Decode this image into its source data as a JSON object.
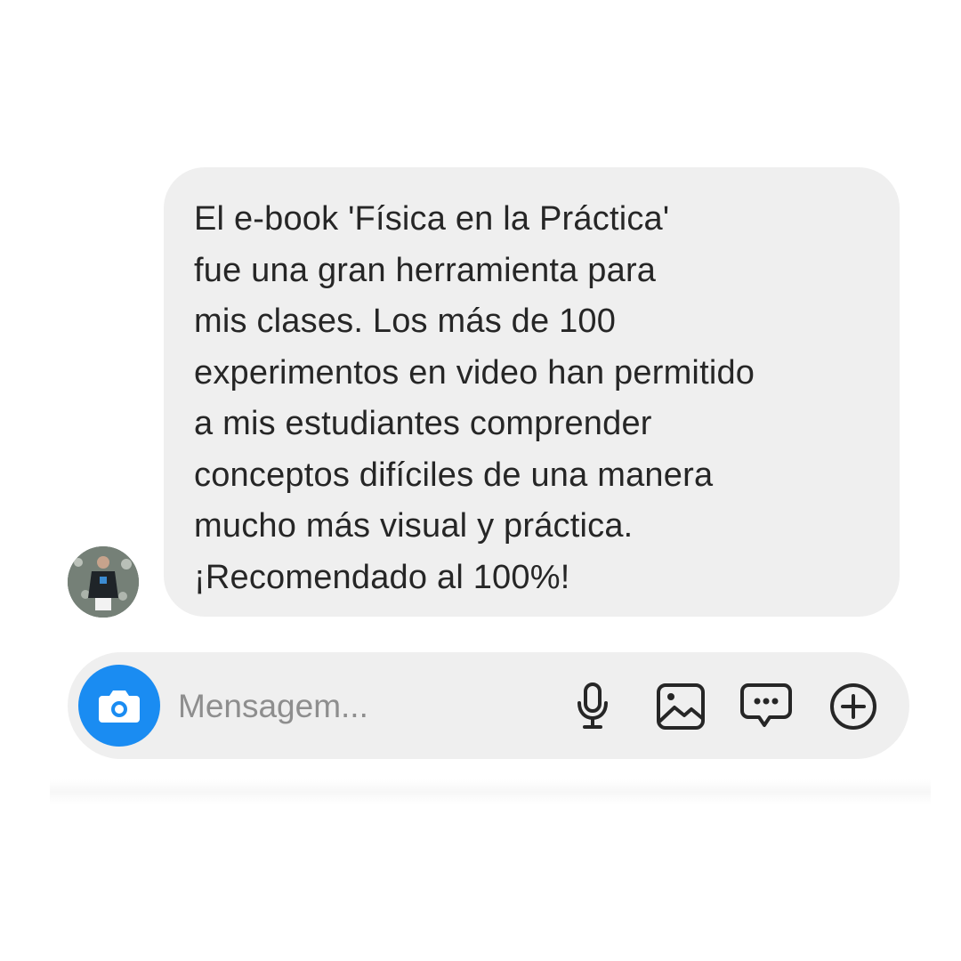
{
  "message": {
    "lines": [
      "El e-book 'Física en la Práctica'",
      "fue una gran herramienta para",
      "mis clases. Los más de 100",
      "experimentos en video han permitido",
      "a mis estudiantes comprender",
      "conceptos difíciles de una manera",
      "mucho más visual y práctica.",
      "¡Recomendado al 100%!"
    ],
    "bubble_color": "#efefef",
    "text_color": "#262626"
  },
  "composer": {
    "placeholder": "Mensagem...",
    "value": "",
    "camera_button_color": "#1a8cf2",
    "icons": {
      "camera": "camera-icon",
      "microphone": "microphone-icon",
      "gallery": "image-gallery-icon",
      "sticker": "chat-bubble-dots-icon",
      "more": "plus-circle-icon"
    }
  },
  "sender": {
    "avatar_icon": "avatar"
  }
}
